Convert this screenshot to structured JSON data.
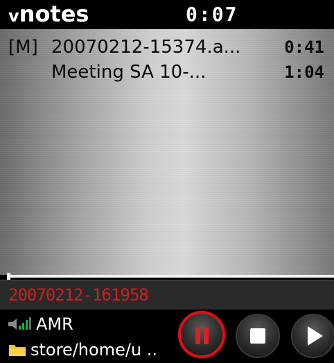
{
  "header": {
    "app_title_prefix": "v",
    "app_title_main": "notes",
    "elapsed": "0:07"
  },
  "recordings": [
    {
      "tag": "[M]",
      "name": "20070212-15374.a...",
      "duration": "0:41"
    },
    {
      "tag": "",
      "name": "Meeting SA 10-...",
      "duration": "1:04"
    }
  ],
  "current": {
    "name": "20070212-161958"
  },
  "status": {
    "codec": "AMR",
    "path": "store/home/u .."
  },
  "icons": {
    "signal": "signal-icon",
    "folder": "folder-icon",
    "pause": "pause-icon",
    "stop": "stop-icon",
    "play": "play-icon"
  },
  "colors": {
    "recording_name": "#d81b1b",
    "pause_ring": "#dd1111"
  }
}
